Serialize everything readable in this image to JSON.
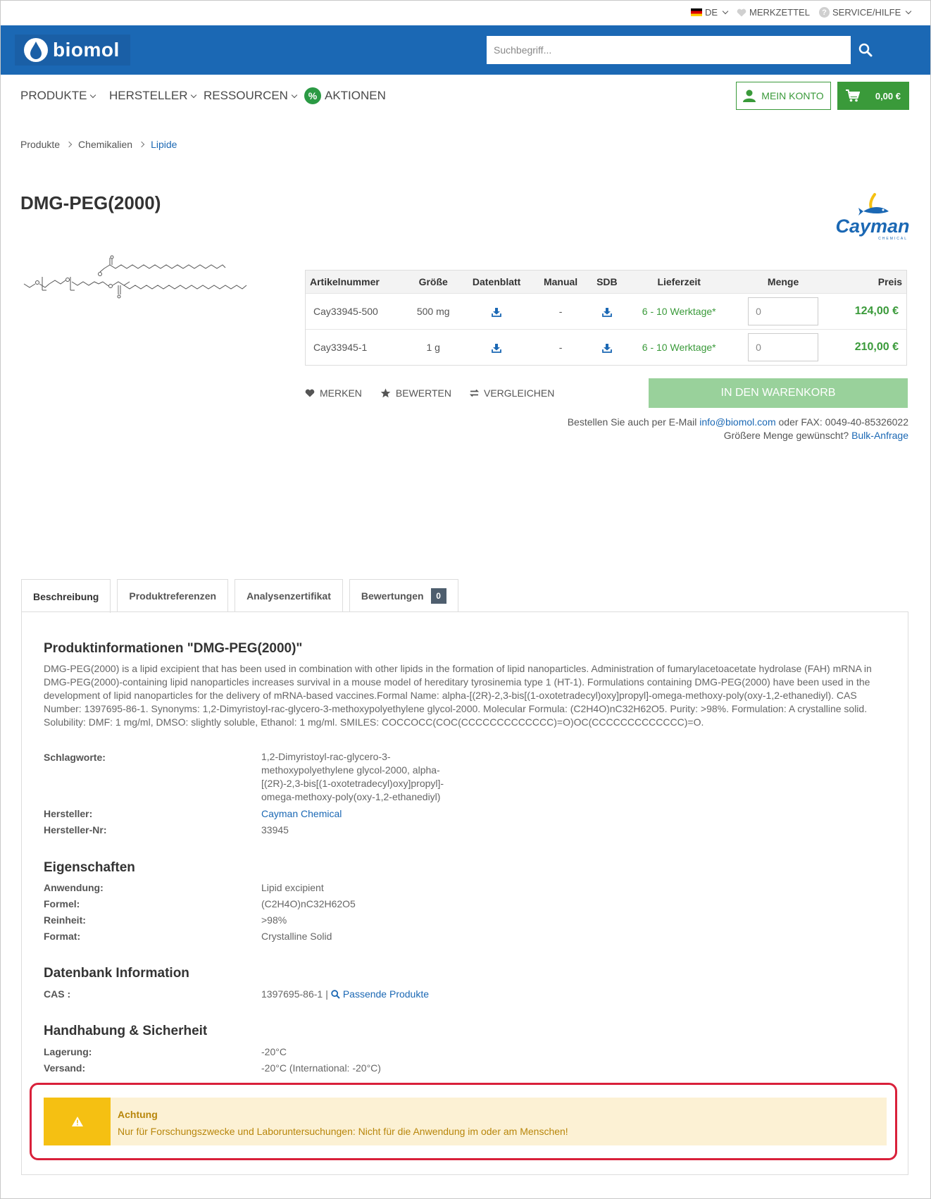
{
  "topbar": {
    "language": "DE",
    "wishlist": "MERKZETTEL",
    "service": "SERVICE/HILFE"
  },
  "header": {
    "logo_text": "biomol",
    "search_placeholder": "Suchbegriff..."
  },
  "nav": {
    "items": [
      "PRODUKTE",
      "HERSTELLER",
      "RESSOURCEN",
      "AKTIONEN"
    ],
    "account": "MEIN KONTO",
    "cart_total": "0,00 €"
  },
  "breadcrumb": [
    "Produkte",
    "Chemikalien",
    "Lipide"
  ],
  "product": {
    "title": "DMG-PEG(2000)",
    "brand_logo_text": "Cayman",
    "brand_logo_sub": "CHEMICAL"
  },
  "table": {
    "headers": [
      "Artikelnummer",
      "Größe",
      "Datenblatt",
      "Manual",
      "SDB",
      "Lieferzeit",
      "Menge",
      "Preis"
    ],
    "rows": [
      {
        "sku": "Cay33945-500",
        "size": "500 mg",
        "manual": "-",
        "delivery": "6 - 10 Werktage*",
        "qty": "0",
        "price": "124,00 €"
      },
      {
        "sku": "Cay33945-1",
        "size": "1 g",
        "manual": "-",
        "delivery": "6 - 10 Werktage*",
        "qty": "0",
        "price": "210,00 €"
      }
    ]
  },
  "actions": {
    "remember": "MERKEN",
    "rate": "BEWERTEN",
    "compare": "VERGLEICHEN",
    "add_to_cart": "IN DEN WARENKORB"
  },
  "order_info": {
    "line1_prefix": "Bestellen Sie auch per E-Mail",
    "email": "info@biomol.com",
    "line1_suffix": "oder FAX: 0049-40-85326022",
    "line2_prefix": "Größere Menge gewünscht?",
    "bulk_link": "Bulk-Anfrage"
  },
  "tabs": {
    "description": "Beschreibung",
    "references": "Produktreferenzen",
    "certificate": "Analysenzertifikat",
    "reviews": "Bewertungen",
    "reviews_count": "0"
  },
  "info": {
    "heading": "Produktinformationen \"DMG-PEG(2000)\"",
    "description": "DMG-PEG(2000) is a lipid excipient that has been used in combination with other lipids in the formation of lipid nanoparticles. Administration of fumarylacetoacetate hydrolase (FAH) mRNA in DMG-PEG(2000)-containing lipid nanoparticles increases survival in a mouse model of hereditary tyrosinemia type 1 (HT-1). Formulations containing DMG-PEG(2000) have been used in the development of lipid nanoparticles for the delivery of mRNA-based vaccines.Formal Name: alpha-[(2R)-2,3-bis[(1-oxotetradecyl)oxy]propyl]-omega-methoxy-poly(oxy-1,2-ethanediyl). CAS Number: 1397695-86-1. Synonyms: 1,2-Dimyristoyl-rac-glycero-3-methoxypolyethylene glycol-2000. Molecular Formula: (C2H4O)nC32H62O5. Purity: >98%. Formulation: A crystalline solid. Solubility: DMF: 1 mg/ml, DMSO: slightly soluble, Ethanol: 1 mg/ml. SMILES: COCCOCC(COC(CCCCCCCCCCCCC)=O)OC(CCCCCCCCCCCCC)=O.",
    "keywords_label": "Schlagworte:",
    "keywords_lines": [
      "1,2-Dimyristoyl-rac-glycero-3-",
      "methoxypolyethylene glycol-2000, alpha-",
      "[(2R)-2,3-bis[(1-oxotetradecyl)oxy]propyl]-",
      "omega-methoxy-poly(oxy-1,2-ethanediyl)"
    ],
    "manufacturer_label": "Hersteller:",
    "manufacturer": "Cayman Chemical",
    "manufacturer_no_label": "Hersteller-Nr:",
    "manufacturer_no": "33945"
  },
  "properties": {
    "heading": "Eigenschaften",
    "application_label": "Anwendung:",
    "application": "Lipid excipient",
    "formula_label": "Formel:",
    "formula": "(C2H4O)nC32H62O5",
    "purity_label": "Reinheit:",
    "purity": ">98%",
    "format_label": "Format:",
    "format": "Crystalline Solid"
  },
  "database": {
    "heading": "Datenbank Information",
    "cas_label": "CAS :",
    "cas": "1397695-86-1",
    "matching": "Passende Produkte"
  },
  "handling": {
    "heading": "Handhabung & Sicherheit",
    "storage_label": "Lagerung:",
    "storage": "-20°C",
    "shipping_label": "Versand:",
    "shipping": "-20°C (International: -20°C)"
  },
  "alert": {
    "title": "Achtung",
    "text": "Nur für Forschungszwecke und Laboruntersuchungen: Nicht für die Anwendung im oder am Menschen!"
  },
  "colors": {
    "brand_blue": "#1b68b4",
    "green": "#3a9a3a",
    "alert_bg": "#fcf1d4",
    "alert_icon_bg": "#f5c012",
    "highlight": "#d9203a"
  }
}
